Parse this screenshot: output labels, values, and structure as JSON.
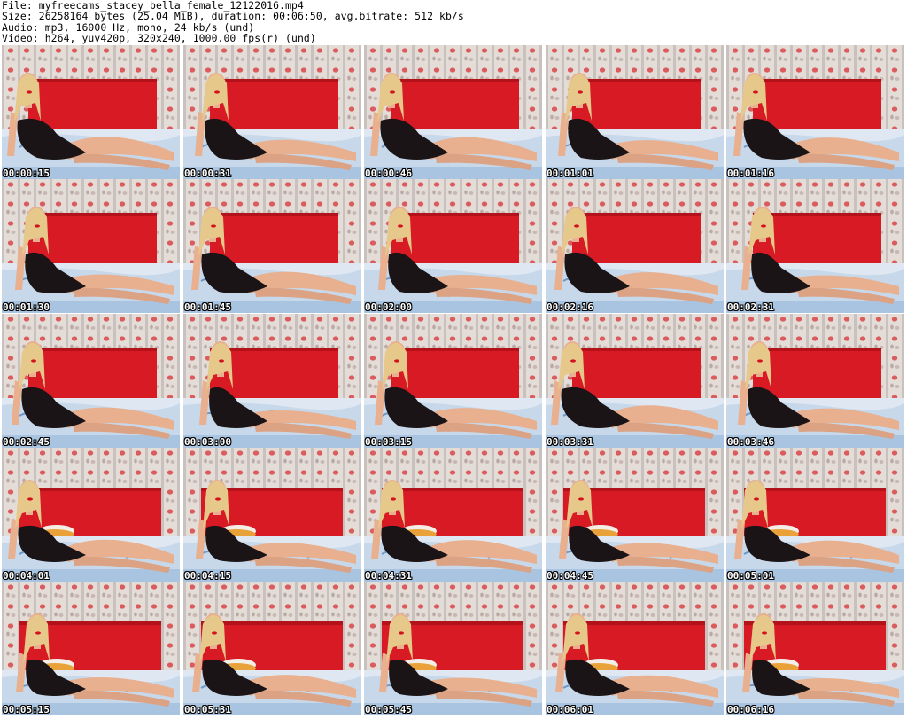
{
  "header": {
    "file_line": "File: myfreecams_stacey_bella_female_12122016.mp4",
    "size_line": "Size: 26258164 bytes (25.04 MiB), duration: 00:06:50, avg.bitrate: 512 kb/s",
    "audio_line": "Audio: mp3, 16000 Hz, mono, 24 kb/s (und)",
    "video_line": "Video: h264, yuv420p, 320x240, 1000.00 fps(r) (und)"
  },
  "grid": {
    "columns": 5,
    "rows": 5
  },
  "frames": [
    {
      "timestamp": "00:00:15",
      "scene": "a"
    },
    {
      "timestamp": "00:00:31",
      "scene": "a"
    },
    {
      "timestamp": "00:00:46",
      "scene": "a"
    },
    {
      "timestamp": "00:01:01",
      "scene": "a"
    },
    {
      "timestamp": "00:01:16",
      "scene": "a"
    },
    {
      "timestamp": "00:01:30",
      "scene": "a"
    },
    {
      "timestamp": "00:01:45",
      "scene": "a"
    },
    {
      "timestamp": "00:02:00",
      "scene": "a"
    },
    {
      "timestamp": "00:02:16",
      "scene": "a"
    },
    {
      "timestamp": "00:02:31",
      "scene": "a"
    },
    {
      "timestamp": "00:02:45",
      "scene": "a"
    },
    {
      "timestamp": "00:03:00",
      "scene": "a"
    },
    {
      "timestamp": "00:03:15",
      "scene": "a"
    },
    {
      "timestamp": "00:03:31",
      "scene": "a"
    },
    {
      "timestamp": "00:03:46",
      "scene": "a"
    },
    {
      "timestamp": "00:04:01",
      "scene": "b"
    },
    {
      "timestamp": "00:04:15",
      "scene": "b"
    },
    {
      "timestamp": "00:04:31",
      "scene": "b"
    },
    {
      "timestamp": "00:04:45",
      "scene": "b"
    },
    {
      "timestamp": "00:05:01",
      "scene": "b"
    },
    {
      "timestamp": "00:05:15",
      "scene": "b"
    },
    {
      "timestamp": "00:05:31",
      "scene": "b"
    },
    {
      "timestamp": "00:05:45",
      "scene": "b"
    },
    {
      "timestamp": "00:06:01",
      "scene": "b"
    },
    {
      "timestamp": "00:06:16",
      "scene": "b"
    }
  ],
  "colors": {
    "headboard": "#d81a24",
    "wall": "#e4dcd6",
    "bedsheet": "#dfe8f2",
    "skin": "#e8b08f",
    "hair": "#e6c98a",
    "outfit": "#1a1416"
  }
}
